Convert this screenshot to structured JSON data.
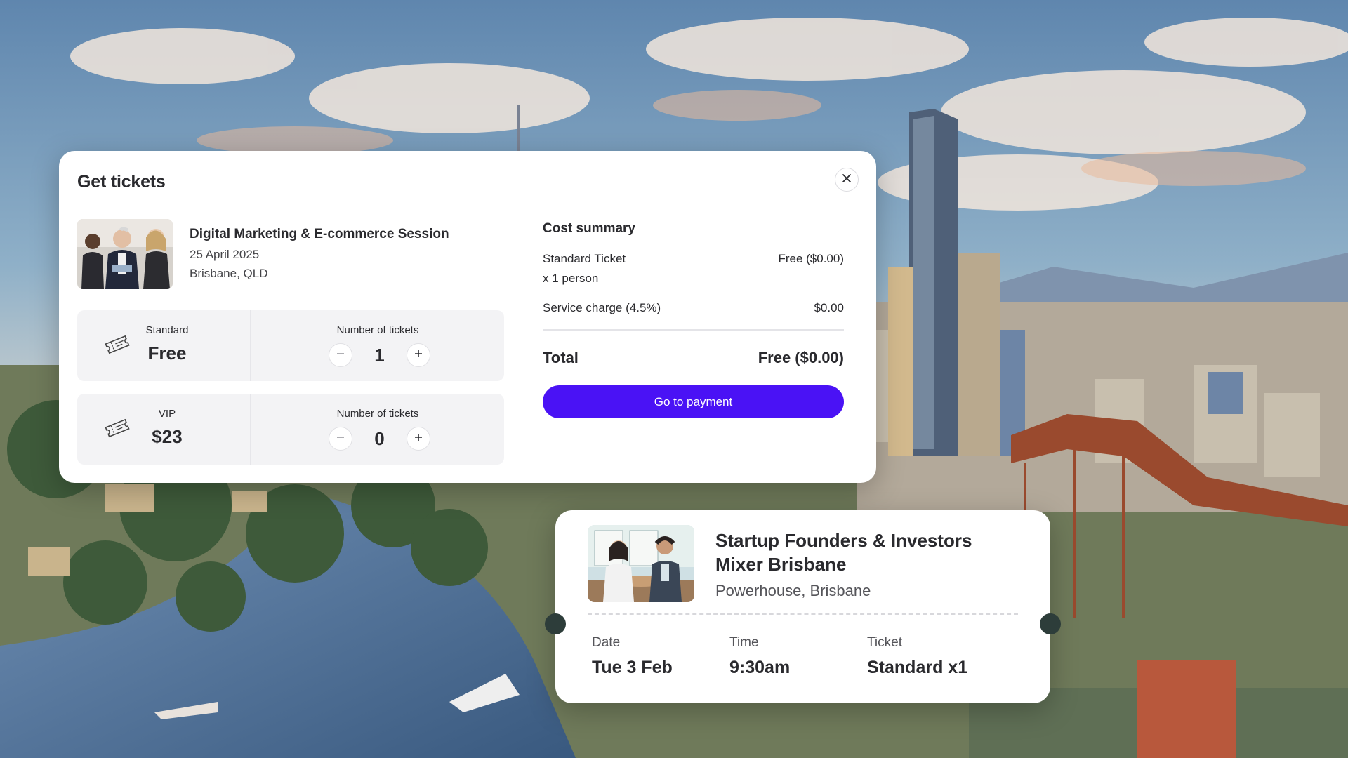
{
  "modal": {
    "title": "Get tickets",
    "event": {
      "name": "Digital Marketing & E-commerce Session",
      "date": "25 April 2025",
      "location": "Brisbane, QLD"
    },
    "tickets": [
      {
        "type": "Standard",
        "price": "Free",
        "count_label": "Number of tickets",
        "count": "1"
      },
      {
        "type": "VIP",
        "price": "$23",
        "count_label": "Number of tickets",
        "count": "0"
      }
    ],
    "summary": {
      "title": "Cost summary",
      "line1_label": "Standard Ticket",
      "line1_sub": "x 1 person",
      "line1_value": "Free ($0.00)",
      "line2_label": "Service charge (4.5%)",
      "line2_value": "$0.00",
      "total_label": "Total",
      "total_value": "Free ($0.00)"
    },
    "pay_button": "Go to payment"
  },
  "card": {
    "title": "Startup Founders & Investors Mixer Brisbane",
    "venue": "Powerhouse, Brisbane",
    "date_label": "Date",
    "date_value": "Tue 3 Feb",
    "time_label": "Time",
    "time_value": "9:30am",
    "ticket_label": "Ticket",
    "ticket_value": "Standard x1"
  },
  "colors": {
    "accent": "#4a12f5",
    "card_bg": "#ffffff",
    "row_bg": "#f3f3f5"
  },
  "icons": [
    "close-icon",
    "ticket-icon",
    "minus-icon",
    "plus-icon"
  ]
}
